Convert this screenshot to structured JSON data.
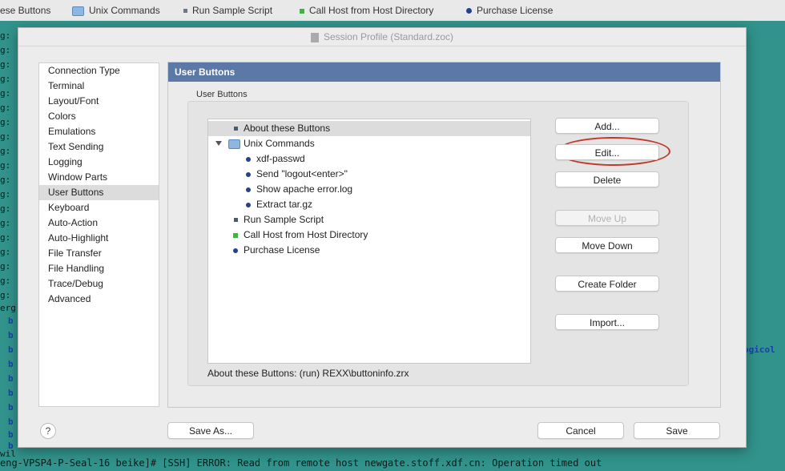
{
  "top_bar": {
    "items": [
      {
        "label": "ese Buttons",
        "icon": "none"
      },
      {
        "label": "Unix Commands",
        "icon": "folder-icon"
      },
      {
        "label": "Run Sample Script",
        "icon": "square-bullet-icon"
      },
      {
        "label": "Call Host from Host Directory",
        "icon": "green-square-icon"
      },
      {
        "label": "Purchase License",
        "icon": "dot-icon"
      }
    ]
  },
  "terminal": {
    "left_fragments": [
      "g:",
      "g:",
      "g:",
      "g:",
      "g:",
      "g:",
      "g:",
      "g:",
      "g:",
      "g:",
      "g:",
      "g:",
      "g:",
      "g:",
      "g:",
      "g:",
      "g:",
      "g:",
      "g:",
      "erg"
    ],
    "blue_fragments": [
      "b",
      "b",
      "b",
      "b",
      "b",
      "b",
      "b",
      "b",
      "b",
      "b"
    ],
    "right_fragment": "ogicol",
    "bottom_left": "wil",
    "status_line": "eng-VPSP4-P-Seal-16 beike]# [SSH] ERROR: Read from remote host newgate.stoff.xdf.cn: Operation timed out"
  },
  "dialog": {
    "title": "Session Profile (Standard.zoc)",
    "sidebar": {
      "items": [
        "Connection Type",
        "Terminal",
        "Layout/Font",
        "Colors",
        "Emulations",
        "Text Sending",
        "Logging",
        "Window Parts",
        "User Buttons",
        "Keyboard",
        "Auto-Action",
        "Auto-Highlight",
        "File Transfer",
        "File Handling",
        "Trace/Debug",
        "Advanced"
      ],
      "selected": "User Buttons"
    },
    "panel": {
      "header": "User Buttons",
      "group_label": "User Buttons",
      "tree": [
        {
          "label": "About these Buttons",
          "icon": "square-bullet-icon",
          "level": 0,
          "selected": true
        },
        {
          "label": "Unix Commands",
          "icon": "folder-icon",
          "level": 0,
          "expanded": true
        },
        {
          "label": "xdf-passwd",
          "icon": "dot-icon",
          "level": 1
        },
        {
          "label": "Send \"logout<enter>\"",
          "icon": "dot-icon",
          "level": 1
        },
        {
          "label": "Show apache error.log",
          "icon": "dot-icon",
          "level": 1
        },
        {
          "label": "Extract tar.gz",
          "icon": "dot-icon",
          "level": 1
        },
        {
          "label": "Run Sample Script",
          "icon": "square-bullet-icon",
          "level": 0
        },
        {
          "label": "Call Host from Host Directory",
          "icon": "green-square-icon",
          "level": 0
        },
        {
          "label": "Purchase License",
          "icon": "dot-icon",
          "level": 0
        }
      ],
      "status_text": "About these Buttons: (run) REXX\\buttoninfo.zrx",
      "buttons": {
        "add": "Add...",
        "edit": "Edit...",
        "delete": "Delete",
        "move_up": "Move Up",
        "move_down": "Move Down",
        "create_folder": "Create Folder",
        "import": "Import..."
      }
    },
    "footer": {
      "help": "?",
      "save_as": "Save As...",
      "cancel": "Cancel",
      "save": "Save"
    }
  },
  "colors": {
    "panel_header": "#5b78a7",
    "terminal_bg": "#31938b",
    "highlight_ring": "#c0392b"
  }
}
